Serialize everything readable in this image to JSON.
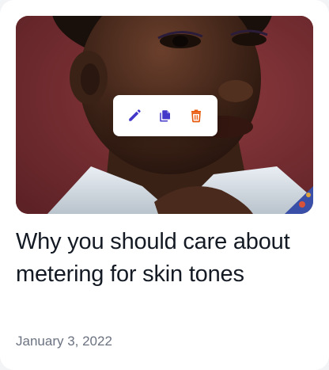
{
  "card": {
    "title": "Why you should care about metering for skin tones",
    "date": "January 3, 2022"
  },
  "toolbar": {
    "actions": [
      {
        "name": "edit",
        "icon": "pencil-icon",
        "color": "#4338ca"
      },
      {
        "name": "duplicate",
        "icon": "copy-icon",
        "color": "#4338ca"
      },
      {
        "name": "delete",
        "icon": "trash-icon",
        "color": "#e8590c"
      }
    ]
  },
  "colors": {
    "title": "#141a24",
    "date": "#6b7280",
    "accent": "#4338ca",
    "danger": "#e8590c",
    "photo_background": "#7a2f33"
  }
}
